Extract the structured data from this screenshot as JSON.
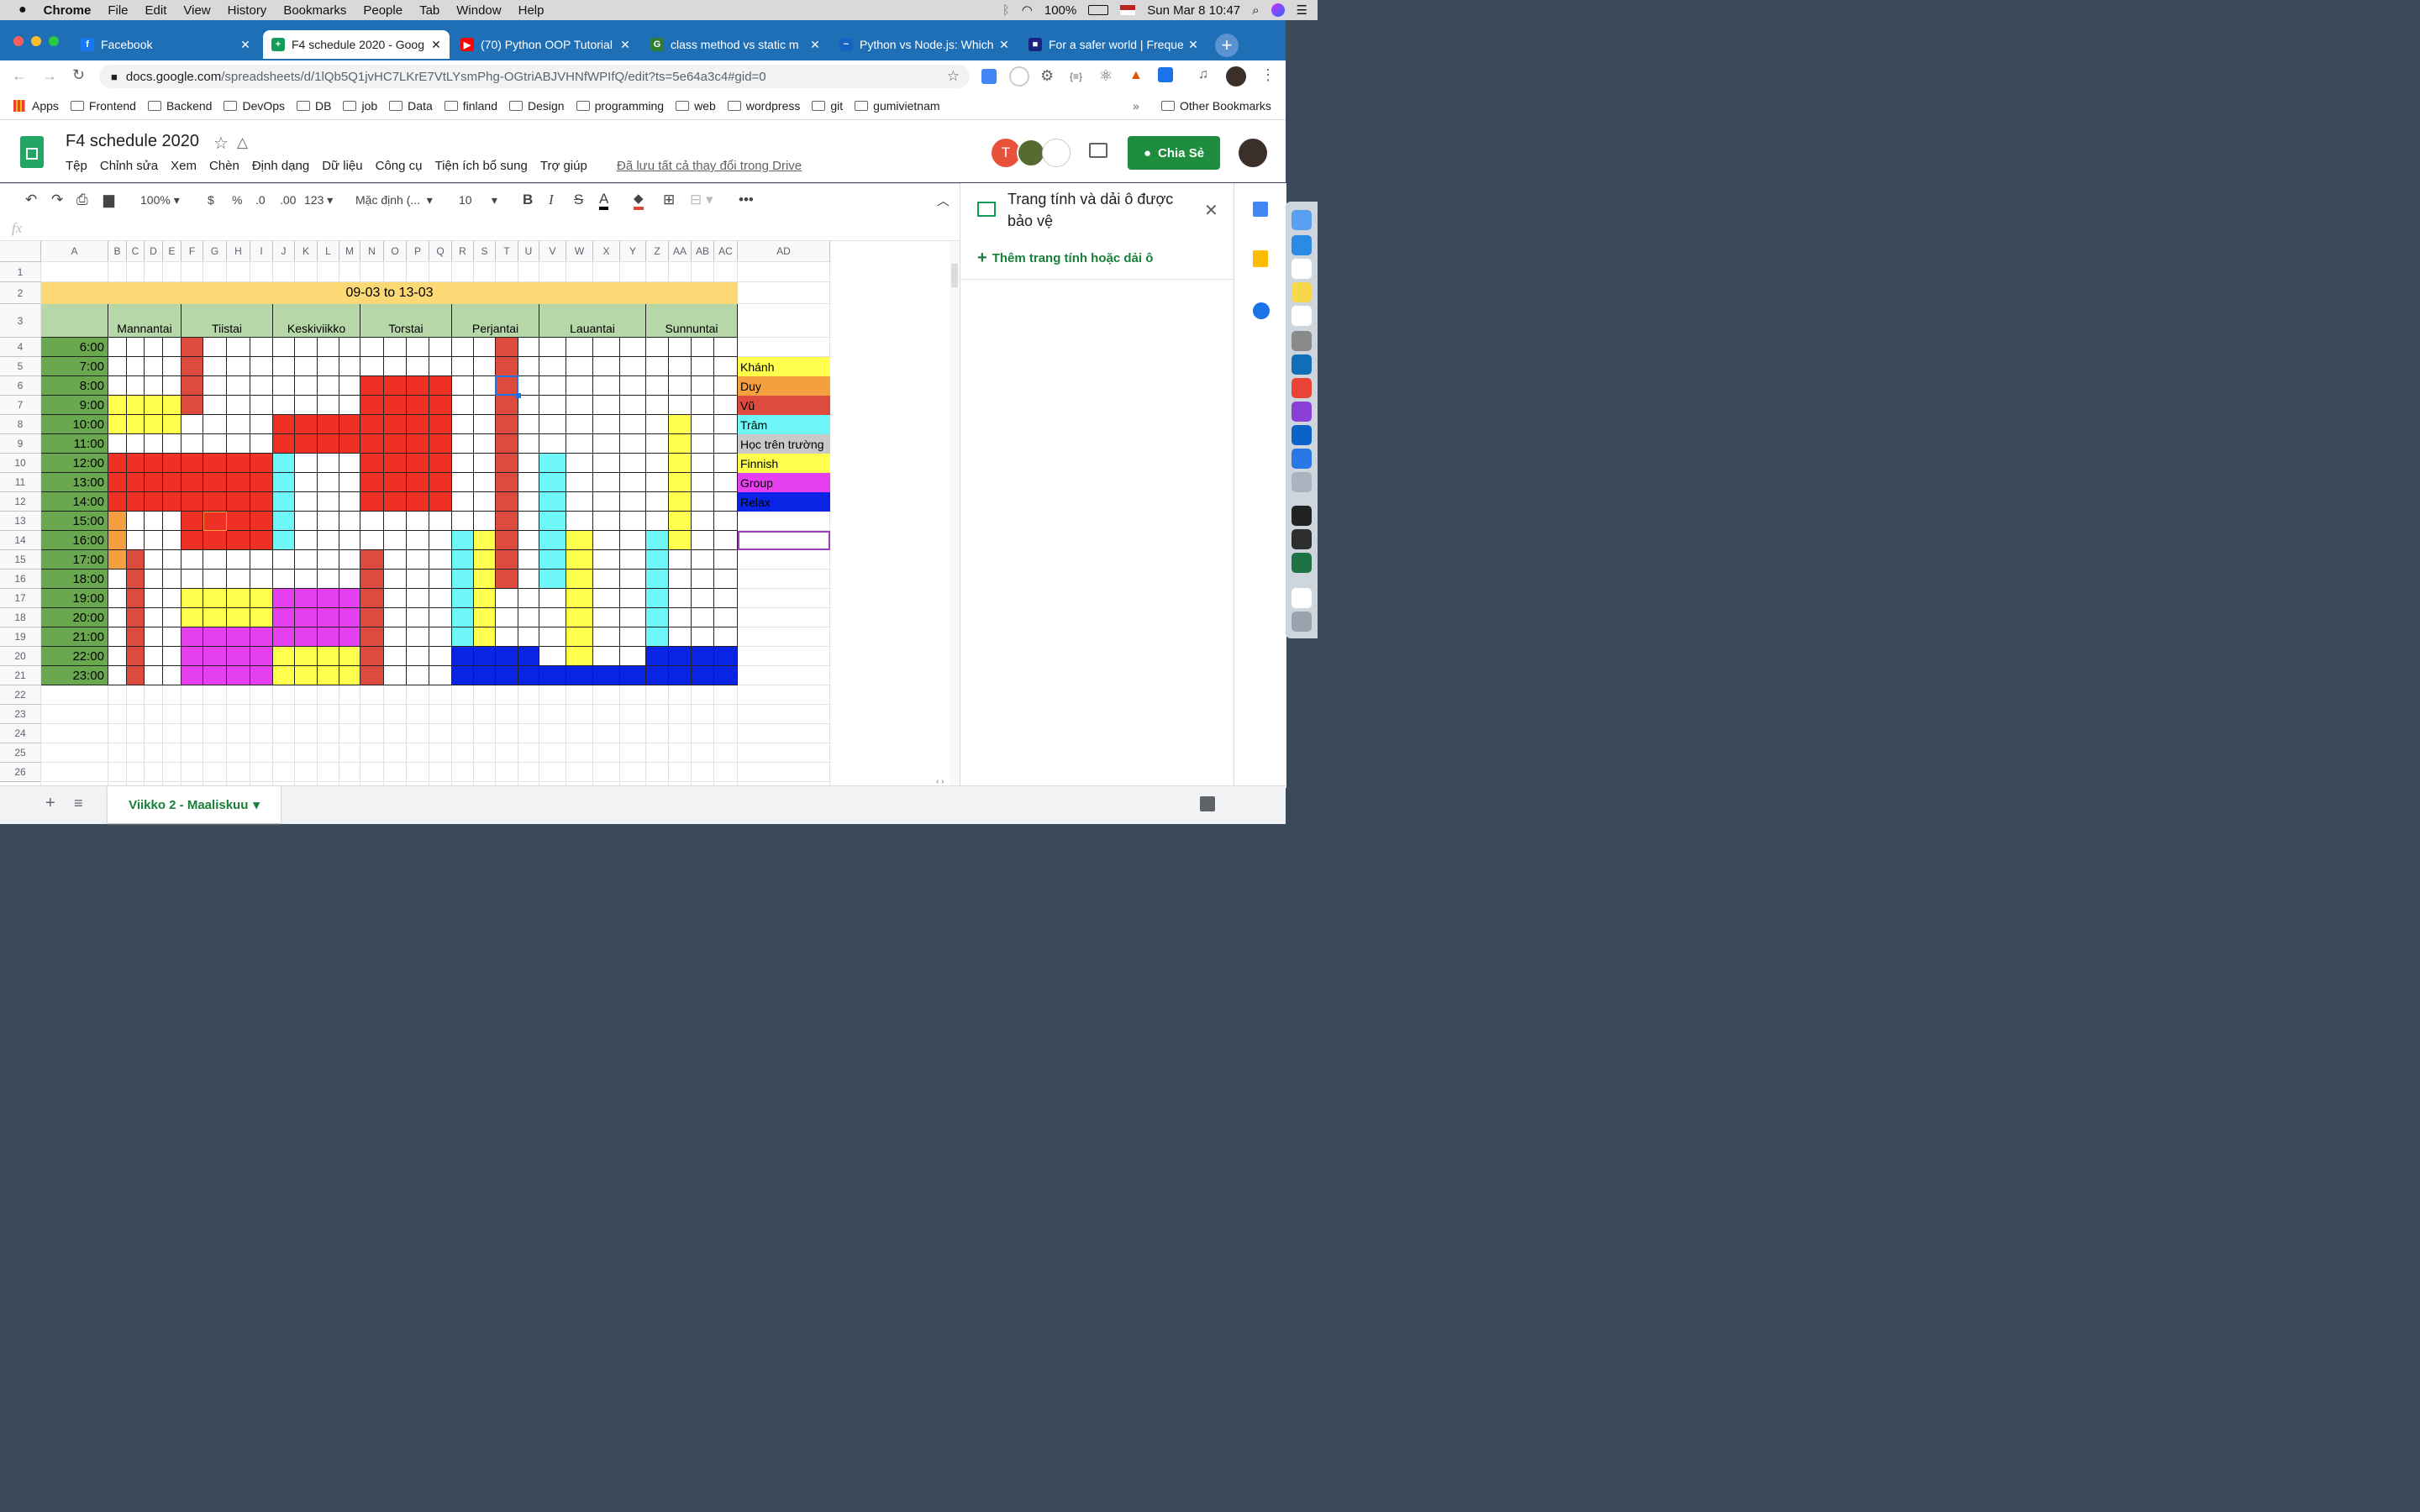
{
  "menubar": {
    "app": "Chrome",
    "items": [
      "File",
      "Edit",
      "View",
      "History",
      "Bookmarks",
      "People",
      "Tab",
      "Window",
      "Help"
    ],
    "battery": "100%",
    "datetime": "Sun Mar 8  10:47"
  },
  "tabs": [
    {
      "title": "Facebook",
      "favicon_color": "#1877f2",
      "glyph": "f"
    },
    {
      "title": "F4 schedule 2020 - Goog",
      "favicon_color": "#0f9d58",
      "glyph": "+"
    },
    {
      "title": "(70) Python OOP Tutorial",
      "favicon_color": "#ff0000",
      "glyph": "▶"
    },
    {
      "title": "class method vs static m",
      "favicon_color": "#2e7d32",
      "glyph": "G"
    },
    {
      "title": "Python vs Node.js: Which",
      "favicon_color": "#1565c0",
      "glyph": "~"
    },
    {
      "title": "For a safer world | Freque",
      "favicon_color": "#1a237e",
      "glyph": "■"
    }
  ],
  "address": {
    "host": "docs.google.com",
    "path": "/spreadsheets/d/1lQb5Q1jvHC7LKrE7VtLYsmPhg-OGtriABJVHNfWPIfQ/edit?ts=5e64a3c4#gid=0"
  },
  "bookmarks": [
    "Apps",
    "Frontend",
    "Backend",
    "DevOps",
    "DB",
    "job",
    "Data",
    "finland",
    "Design",
    "programming",
    "web",
    "wordpress",
    "git",
    "gumivietnam"
  ],
  "bookmarks_more": "»",
  "bookmarks_other": "Other Bookmarks",
  "doc": {
    "title": "F4 schedule 2020",
    "menus": [
      "Tệp",
      "Chỉnh sửa",
      "Xem",
      "Chèn",
      "Định dạng",
      "Dữ liệu",
      "Công cụ",
      "Tiện ích bổ sung",
      "Trợ giúp"
    ],
    "saved": "Đã lưu tất cả thay đổi trong Drive",
    "share": "Chia Sẻ",
    "avatar_letter": "T"
  },
  "toolbar": {
    "zoom": "100%",
    "currency": "$",
    "percent": "%",
    "dec_less": ".0",
    "dec_more": ".00",
    "format": "123",
    "font": "Mặc định (...",
    "size": "10"
  },
  "fx": "fx",
  "panel": {
    "title": "Trang tính và dải ô được bảo vệ",
    "add": "Thêm trang tính hoặc dải ô"
  },
  "sheet_tab": "Viikko 2 -   Maaliskuu",
  "columns": [
    "A",
    "B",
    "C",
    "D",
    "E",
    "F",
    "G",
    "H",
    "I",
    "J",
    "K",
    "L",
    "M",
    "N",
    "O",
    "P",
    "Q",
    "R",
    "S",
    "T",
    "U",
    "V",
    "W",
    "X",
    "Y",
    "Z",
    "AA",
    "AB",
    "AC",
    "AD"
  ],
  "rows": [
    "1",
    "2",
    "3",
    "4",
    "5",
    "6",
    "7",
    "8",
    "9",
    "10",
    "11",
    "12",
    "13",
    "14",
    "15",
    "16",
    "17",
    "18",
    "19",
    "20",
    "21",
    "22",
    "23",
    "24",
    "25",
    "26"
  ],
  "schedule": {
    "title": "09-03 to 13-03",
    "days": [
      "Mannantai",
      "Tiistai",
      "Keskiviikko",
      "Torstai",
      "Perjantai",
      "Lauantai",
      "Sunnuntai"
    ],
    "times": [
      "6:00",
      "7:00",
      "8:00",
      "9:00",
      "10:00",
      "11:00",
      "12:00",
      "13:00",
      "14:00",
      "15:00",
      "16:00",
      "17:00",
      "18:00",
      "19:00",
      "20:00",
      "21:00",
      "22:00",
      "23:00"
    ]
  },
  "legend": [
    {
      "name": "Khánh",
      "color": "#ffff4d"
    },
    {
      "name": " Duy",
      "color": "#f4a040"
    },
    {
      "name": "Vũ",
      "color": "#dd4b3e"
    },
    {
      "name": " Trâm",
      "color": "#6ff7f7"
    },
    {
      "name": "Học trên trường",
      "color": "#c9c9c9"
    },
    {
      "name": "Finnish",
      "color": "#ffff4d"
    },
    {
      "name": "Group",
      "color": "#e63ff0"
    },
    {
      "name": "Relax",
      "color": "#0a24e6"
    }
  ],
  "colors": {
    "green_time": "#6aa84f",
    "title_yellow": "#fcd974",
    "day_green": "#b6d7a8",
    "red": "#ee3124",
    "vu_red": "#dd4b3e",
    "yellow": "#ffff4d",
    "orange": "#f4a040",
    "cyan": "#6ff7f7",
    "magenta": "#e63ff0",
    "blue": "#0a24e6",
    "tab_blue": "#1f6fb7",
    "share_green": "#1e8e3e"
  }
}
